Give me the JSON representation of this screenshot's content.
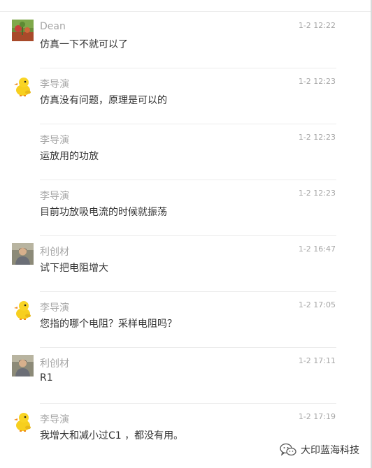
{
  "messages": [
    {
      "avatar": "landscape-avatar-icon",
      "name": "Dean",
      "time": "1-2 12:22",
      "text": "仿真一下不就可以了"
    },
    {
      "avatar": "duck-avatar-icon",
      "name": "李导演",
      "time": "1-2 12:23",
      "text": "仿真没有问题，原理是可以的"
    },
    {
      "avatar": "",
      "name": "李导演",
      "time": "1-2 12:23",
      "text": "运放用的功放"
    },
    {
      "avatar": "",
      "name": "李导演",
      "time": "1-2 12:23",
      "text": "目前功放吸电流的时候就振荡"
    },
    {
      "avatar": "person-avatar-icon",
      "name": "利创材",
      "time": "1-2 16:47",
      "text": "试下把电阻增大"
    },
    {
      "avatar": "duck-avatar-icon",
      "name": "李导演",
      "time": "1-2 17:05",
      "text": "您指的哪个电阻？采样电阻吗？"
    },
    {
      "avatar": "person-avatar-icon",
      "name": "利创材",
      "time": "1-2 17:11",
      "text": "R1"
    },
    {
      "avatar": "duck-avatar-icon",
      "name": "李导演",
      "time": "1-2 17:19",
      "text": "我增大和减小过C1 ，都没有用。"
    }
  ],
  "watermark": {
    "icon": "wechat-icon",
    "label": "大印蓝海科技"
  }
}
